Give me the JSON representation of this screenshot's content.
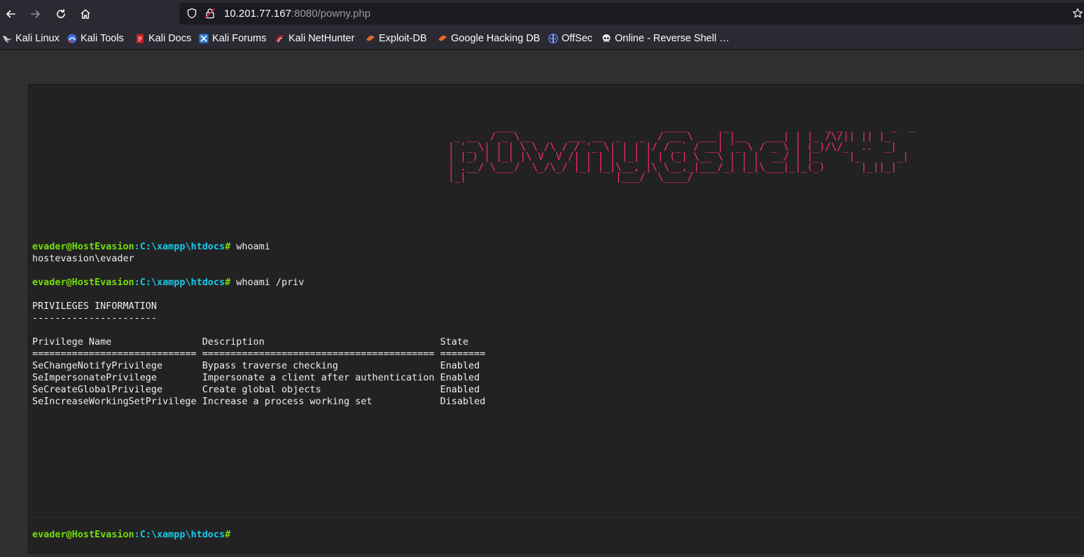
{
  "browser": {
    "url_host": "10.201.77.167",
    "url_rest": ":8080/powny.php"
  },
  "bookmarks": [
    {
      "label": "Kali Linux",
      "icon": "kali-dragon-icon"
    },
    {
      "label": "Kali Tools",
      "icon": "kali-tools-icon"
    },
    {
      "label": "Kali Docs",
      "icon": "kali-docs-icon"
    },
    {
      "label": "Kali Forums",
      "icon": "kali-forums-icon"
    },
    {
      "label": "Kali NetHunter",
      "icon": "nethunter-icon"
    },
    {
      "label": "Exploit-DB",
      "icon": "exploit-db-icon"
    },
    {
      "label": "Google Hacking DB",
      "icon": "ghdb-icon"
    },
    {
      "label": "OffSec",
      "icon": "offsec-icon"
    },
    {
      "label": "Online - Reverse Shell …",
      "icon": "skull-icon"
    }
  ],
  "colors": {
    "banner": "#ff2c6d",
    "prompt_user": "#75df0b",
    "prompt_path": "#1bc9e7",
    "terminal_bg": "#222222"
  },
  "terminal": {
    "banner": "        ___                         ____      _                _ _        _  _   \n _ __  / _ \\__      ___ __  _   _  / __ \\ ___| |__   ___| | |_ /\\/|| || |_ \n| '_ \\| | | \\ \\ /\\ / / '_ \\| | | |/ / _` / __| '_ \\ / _ \\ | (_)/\\/_  ..  _|\n| |_) | |_| |\\ V  V /| | | | |_| | | (_| \\__ \\ | | |  __/ | |_     |_      _|\n| .__/ \\___/  \\_/\\_/ |_| |_|\\__, |\\ \\__,_|___/_| |_|\\___|_|_(_)      |_||_|  \n|_|                         |___/  \\____/                                    ",
    "prompt_user": "evader@HostEvasion",
    "prompt_sep": ":",
    "prompt_path": "C:\\xampp\\htdocs",
    "prompt_end": "#",
    "cmd1": " whoami",
    "out1": "hostevasion\\evader",
    "cmd2": " whoami /priv",
    "priv_title": "PRIVILEGES INFORMATION",
    "priv_rule": "----------------------",
    "table_header": "Privilege Name                Description                               State",
    "table_rule": "============================= ========================================= ========",
    "rows": [
      "SeChangeNotifyPrivilege       Bypass traverse checking                  Enabled",
      "SeImpersonatePrivilege        Impersonate a client after authentication Enabled",
      "SeCreateGlobalPrivilege       Create global objects                     Enabled",
      "SeIncreaseWorkingSetPrivilege Increase a process working set            Disabled"
    ]
  }
}
